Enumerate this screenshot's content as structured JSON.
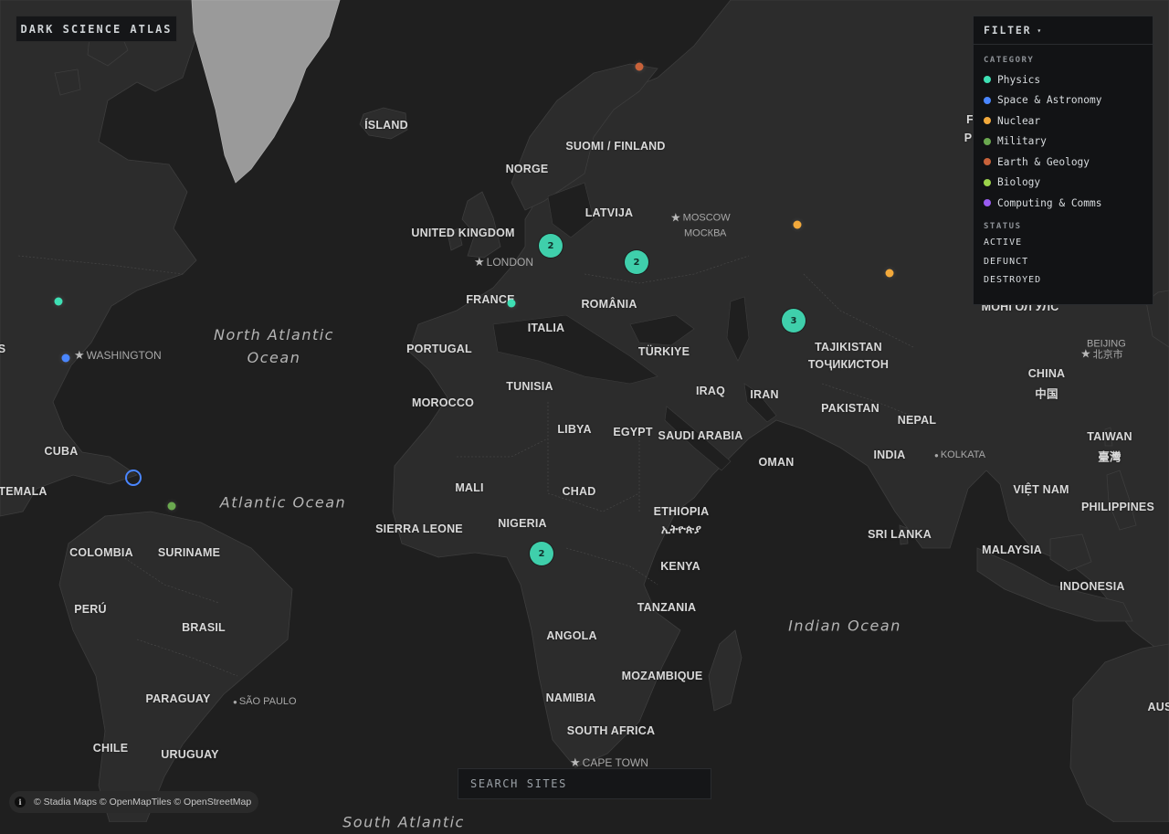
{
  "app_title": "DARK SCIENCE ATLAS",
  "filter": {
    "header": "FILTER",
    "caret": "▾",
    "category_heading": "CATEGORY",
    "categories": [
      {
        "label": "Physics",
        "color": "#3ee0b4"
      },
      {
        "label": "Space & Astronomy",
        "color": "#4a86ff"
      },
      {
        "label": "Nuclear",
        "color": "#f2a93b"
      },
      {
        "label": "Military",
        "color": "#6aa84f"
      },
      {
        "label": "Earth & Geology",
        "color": "#c8623a"
      },
      {
        "label": "Biology",
        "color": "#9bd34a"
      },
      {
        "label": "Computing & Comms",
        "color": "#9a5cf2"
      }
    ],
    "status_heading": "STATUS",
    "statuses": [
      "ACTIVE",
      "DEFUNCT",
      "DESTROYED"
    ]
  },
  "search": {
    "placeholder": "SEARCH SITES"
  },
  "attribution": {
    "info": "i",
    "text": "© Stadia Maps © OpenMapTiles © OpenStreetMap"
  },
  "map": {
    "oceans": [
      {
        "line1": "North Atlantic",
        "line2": "Ocean"
      },
      {
        "line1": "Atlantic Ocean",
        "line2": ""
      },
      {
        "line1": "Indian Ocean",
        "line2": ""
      },
      {
        "line1": "South Atlantic",
        "line2": ""
      }
    ],
    "countries": [
      "ÍSLAND",
      "SUOMI / FINLAND",
      "NORGE",
      "LATVIJA",
      "UNITED KINGDOM",
      "FRANCE",
      "ROMÂNIA",
      "ITALIA",
      "PORTUGAL",
      "TÜRKIYE",
      "TAJIKISTAN",
      "ТОҶИКИСТОН",
      "MOROCCO",
      "TUNISIA",
      "IRAQ",
      "IRAN",
      "PAKISTAN",
      "NEPAL",
      "CHINA",
      "中国",
      "LIBYA",
      "EGYPT",
      "SAUDI ARABIA",
      "OMAN",
      "INDIA",
      "TAIWAN",
      "臺灣",
      "CUBA",
      "TEMALA",
      "MALI",
      "CHAD",
      "ETHIOPIA",
      "ኢትዮጵያ",
      "VIỆT NAM",
      "PHILIPPINES",
      "SIERRA LEONE",
      "NIGERIA",
      "SRI LANKA",
      "COLOMBIA",
      "SURINAME",
      "KENYA",
      "MALAYSIA",
      "PERÚ",
      "INDONESIA",
      "BRASIL",
      "TANZANIA",
      "ANGOLA",
      "MOZAMBIQUE",
      "NAMIBIA",
      "PARAGUAY",
      "SOUTH AFRICA",
      "CHILE",
      "URUGUAY",
      "MOНГОЛ УЛС",
      "AUS",
      "S",
      "F",
      "P"
    ],
    "cities": {
      "moscow": {
        "line1": "MOSCOW",
        "line2": "МОСКВА"
      },
      "london": "LONDON",
      "washington": "WASHINGTON",
      "beijing": {
        "line1": "BEIJING",
        "line2": "北京市"
      },
      "kolkata": "KOLKATA",
      "sao_paulo": "SÃO PAULO",
      "cape_town": "CAPE TOWN"
    },
    "clusters": [
      "2",
      "2",
      "3",
      "2"
    ]
  }
}
